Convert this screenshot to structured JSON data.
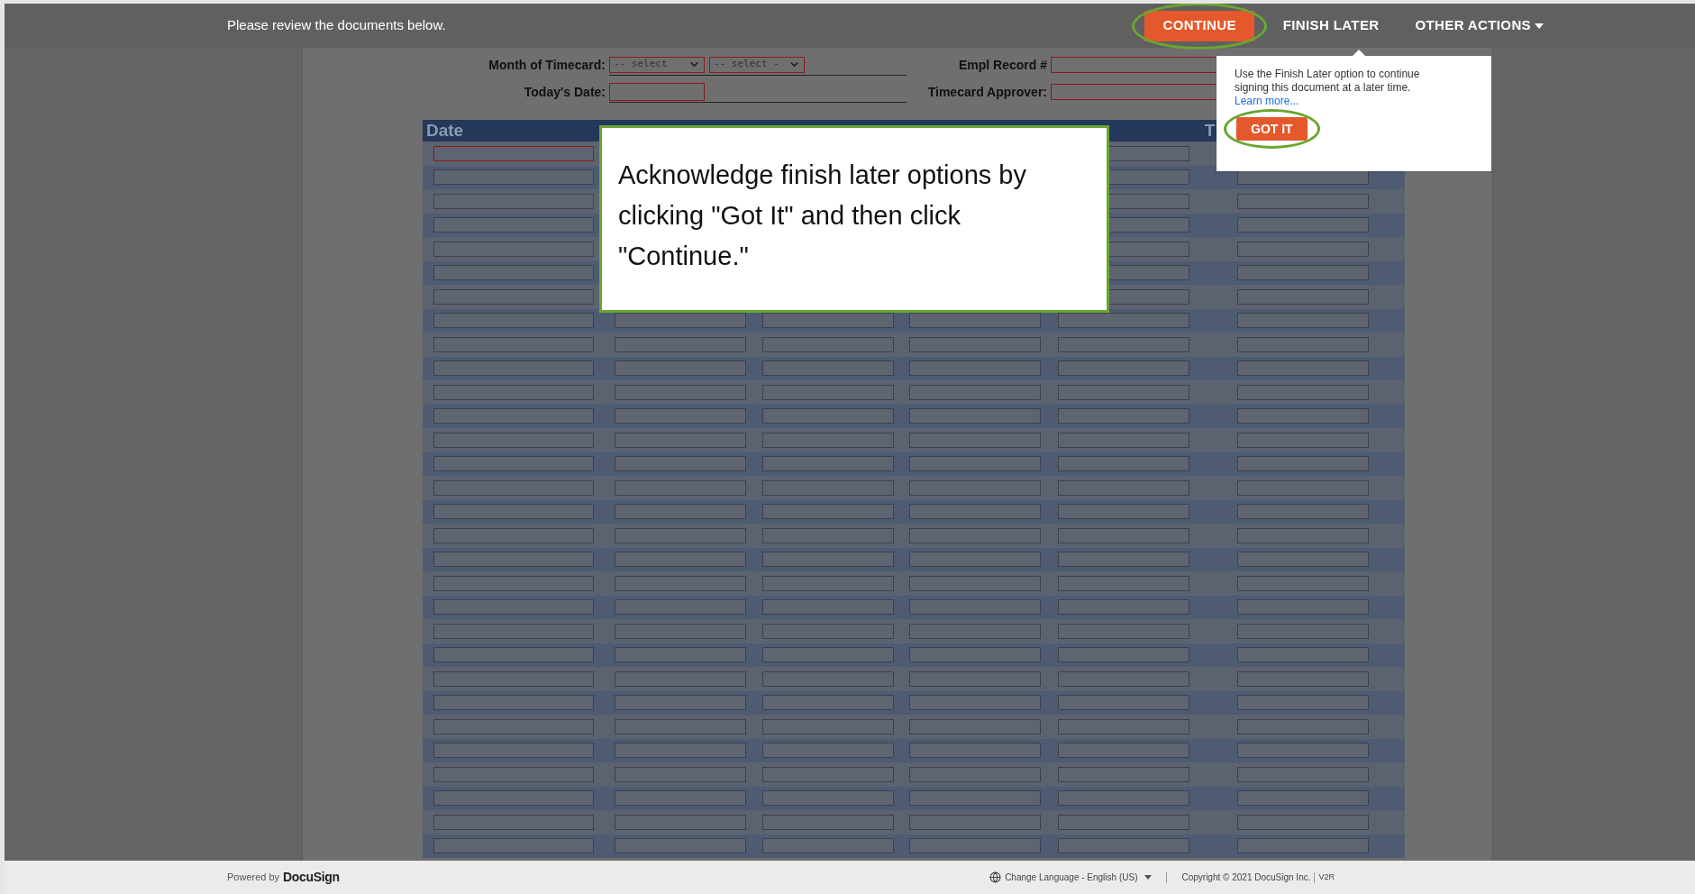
{
  "top_bar": {
    "message": "Please review the documents below.",
    "actions": [
      {
        "label": "CONTINUE",
        "kind": "primary",
        "highlighted": true
      },
      {
        "label": "FINISH LATER",
        "kind": "link",
        "highlighted": false
      },
      {
        "label": "OTHER ACTIONS",
        "kind": "menu",
        "highlighted": false
      }
    ]
  },
  "form": {
    "left": [
      {
        "label": "Month of Timecard:",
        "kind": "selects",
        "required": true,
        "options": [
          "-- select",
          "-- select -"
        ]
      },
      {
        "label": "Today's Date:",
        "kind": "input",
        "required": true
      }
    ],
    "right": [
      {
        "label": "Empl Record #",
        "required": true
      },
      {
        "label": "Timecard Approver:",
        "required": true
      }
    ]
  },
  "table": {
    "date_header": "Date",
    "last_header": "T",
    "rows": [
      {
        "required": true
      },
      {
        "required": false
      },
      {
        "required": false
      },
      {
        "required": false
      },
      {
        "required": false
      },
      {
        "required": false
      },
      {
        "required": false
      },
      {
        "required": false
      },
      {
        "required": false
      },
      {
        "required": false
      },
      {
        "required": false
      },
      {
        "required": false
      },
      {
        "required": false
      },
      {
        "required": false
      },
      {
        "required": false
      },
      {
        "required": false
      },
      {
        "required": false
      },
      {
        "required": false
      },
      {
        "required": false
      },
      {
        "required": false
      },
      {
        "required": false
      },
      {
        "required": false
      },
      {
        "required": false
      },
      {
        "required": false
      },
      {
        "required": false
      },
      {
        "required": false
      },
      {
        "required": false
      },
      {
        "required": false
      },
      {
        "required": false
      },
      {
        "required": false
      }
    ]
  },
  "popover": {
    "text": "Use the Finish Later option to continue signing this document at a later time.",
    "link": "Learn more...",
    "button": "GOT IT",
    "button_highlighted": true
  },
  "callout": {
    "text": "Acknowledge finish later options by clicking \"Got It\" and then click \"Continue.\""
  },
  "footer": {
    "powered_by": "Powered by",
    "brand": "DocuSign",
    "language": "Change Language - English (US)",
    "copyright": "Copyright © 2021 DocuSign Inc.",
    "version": "V2R"
  }
}
